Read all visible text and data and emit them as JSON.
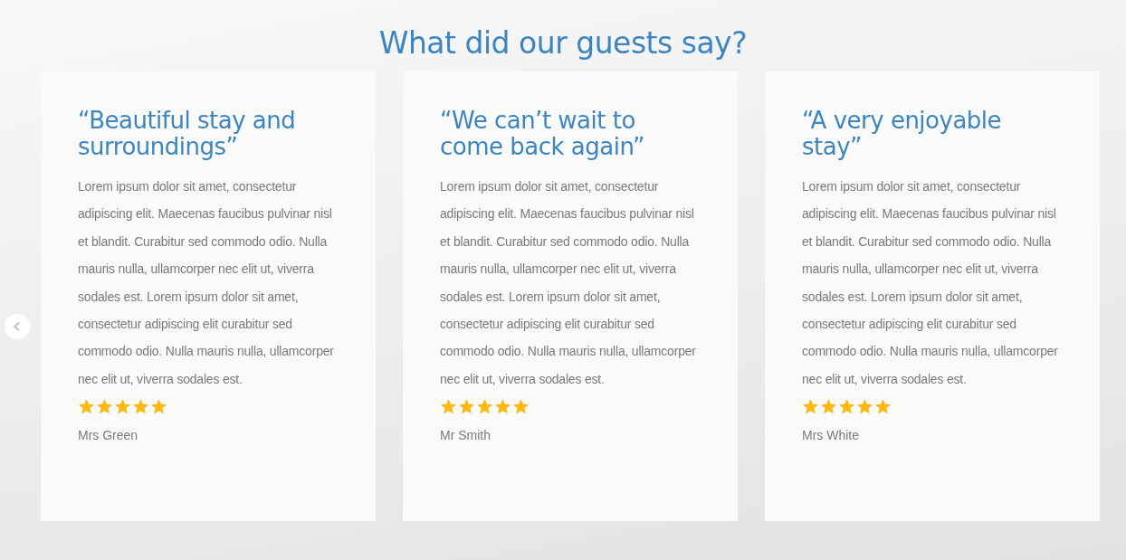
{
  "heading": "What did our guests say?",
  "reviews": [
    {
      "title": "“Beautiful stay and surroundings”",
      "body": "Lorem ipsum dolor sit amet, consectetur adipiscing elit. Maecenas faucibus pulvinar nisl et blandit. Curabitur sed commodo odio. Nulla mauris nulla, ullamcorper nec elit ut, viverra sodales est. Lorem ipsum dolor sit amet, consectetur adipiscing elit curabitur sed commodo odio. Nulla mauris nulla, ullamcorper nec elit ut, viverra sodales est.",
      "stars": 5,
      "author": "Mrs Green"
    },
    {
      "title": "“We can’t wait to come back again”",
      "body": "Lorem ipsum dolor sit amet, consectetur adipiscing elit. Maecenas faucibus pulvinar nisl et blandit. Curabitur sed commodo odio. Nulla mauris nulla, ullamcorper nec elit ut, viverra sodales est. Lorem ipsum dolor sit amet, consectetur adipiscing elit curabitur sed commodo odio. Nulla mauris nulla, ullamcorper nec elit ut, viverra sodales est.",
      "stars": 5,
      "author": "Mr Smith"
    },
    {
      "title": "“A very enjoyable stay”",
      "body": "Lorem ipsum dolor sit amet, consectetur adipiscing elit. Maecenas faucibus pulvinar nisl et blandit. Curabitur sed commodo odio. Nulla mauris nulla, ullamcorper nec elit ut, viverra sodales est. Lorem ipsum dolor sit amet, consectetur adipiscing elit curabitur sed commodo odio. Nulla mauris nulla, ullamcorper nec elit ut, viverra sodales est.",
      "stars": 5,
      "author": "Mrs White"
    }
  ]
}
